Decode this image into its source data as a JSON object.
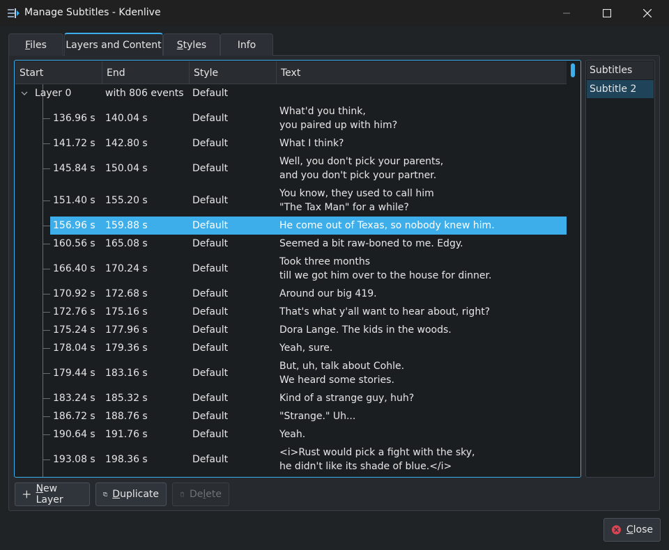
{
  "window": {
    "title": "Manage Subtitles - Kdenlive"
  },
  "tabs": [
    {
      "label": "Files",
      "mnemonic": "F",
      "rest": "iles"
    },
    {
      "label": "Layers and Content",
      "mnemonic": "",
      "rest": "Layers and Content"
    },
    {
      "label": "Styles",
      "mnemonic": "S",
      "rest": "tyles"
    },
    {
      "label": "Info",
      "mnemonic": "",
      "rest": "Info"
    }
  ],
  "tree": {
    "headers": {
      "start": "Start",
      "end": "End",
      "style": "Style",
      "text": "Text"
    },
    "layer": {
      "name": "Layer 0",
      "events": "with 806 events",
      "style": "Default"
    },
    "rows": [
      {
        "start": "136.96 s",
        "end": "140.04 s",
        "style": "Default",
        "line1": "What'd you think,",
        "line2": "you paired up with him?"
      },
      {
        "start": "141.72 s",
        "end": "142.80 s",
        "style": "Default",
        "line1": "What I think?",
        "line2": ""
      },
      {
        "start": "145.84 s",
        "end": "150.04 s",
        "style": "Default",
        "line1": "Well, you don't pick your parents,",
        "line2": "and you don't pick your partner."
      },
      {
        "start": "151.40 s",
        "end": "155.20 s",
        "style": "Default",
        "line1": "You know, they used to call him",
        "line2": "\"The Tax Man\" for a while?"
      },
      {
        "start": "156.96 s",
        "end": "159.88 s",
        "style": "Default",
        "line1": "He come out of Texas, so nobody knew him.",
        "line2": ""
      },
      {
        "start": "160.56 s",
        "end": "165.08 s",
        "style": "Default",
        "line1": "Seemed a bit raw-boned to me. Edgy.",
        "line2": ""
      },
      {
        "start": "166.40 s",
        "end": "170.24 s",
        "style": "Default",
        "line1": "Took three months",
        "line2": "till we got him over to the house for dinner."
      },
      {
        "start": "170.92 s",
        "end": "172.68 s",
        "style": "Default",
        "line1": "Around our big 419.",
        "line2": ""
      },
      {
        "start": "172.76 s",
        "end": "175.16 s",
        "style": "Default",
        "line1": "That's what y'all want to hear about, right?",
        "line2": ""
      },
      {
        "start": "175.24 s",
        "end": "177.96 s",
        "style": "Default",
        "line1": "Dora Lange. The kids in the woods.",
        "line2": ""
      },
      {
        "start": "178.04 s",
        "end": "179.36 s",
        "style": "Default",
        "line1": "Yeah, sure.",
        "line2": ""
      },
      {
        "start": "179.44 s",
        "end": "183.16 s",
        "style": "Default",
        "line1": "But, uh, talk about Cohle.",
        "line2": "We heard some stories."
      },
      {
        "start": "183.24 s",
        "end": "185.32 s",
        "style": "Default",
        "line1": "Kind of a strange guy, huh?",
        "line2": ""
      },
      {
        "start": "186.72 s",
        "end": "188.76 s",
        "style": "Default",
        "line1": "\"Strange.\" Uh...",
        "line2": ""
      },
      {
        "start": "190.64 s",
        "end": "191.76 s",
        "style": "Default",
        "line1": "Yeah.",
        "line2": ""
      },
      {
        "start": "193.08 s",
        "end": "198.36 s",
        "style": "Default",
        "line1": "<i>Rust would pick a fight with the sky,",
        "line2": "he didn't like its shade of blue.</i>"
      }
    ],
    "selected_index": 4
  },
  "subtitles": {
    "header": "Subtitles",
    "items": [
      "Subtitle 2"
    ]
  },
  "buttons": {
    "new_layer": {
      "mnemonic": "N",
      "rest": "ew Layer"
    },
    "duplicate": {
      "mnemonic": "D",
      "rest": "uplicate"
    },
    "delete": {
      "mnemonic": "",
      "rest": "Delete",
      "prefix": "De",
      "mn": "l",
      "suffix": "ete"
    },
    "close": {
      "mnemonic": "C",
      "rest": "lose"
    }
  },
  "colors": {
    "accent": "#3daee9",
    "close_icon": "#da4453"
  },
  "icons": [
    "kdenlive-app-icon",
    "minimize-icon",
    "maximize-icon",
    "close-icon",
    "chevron-down-icon",
    "plus-icon",
    "duplicate-icon",
    "trash-icon",
    "close-circle-icon"
  ]
}
